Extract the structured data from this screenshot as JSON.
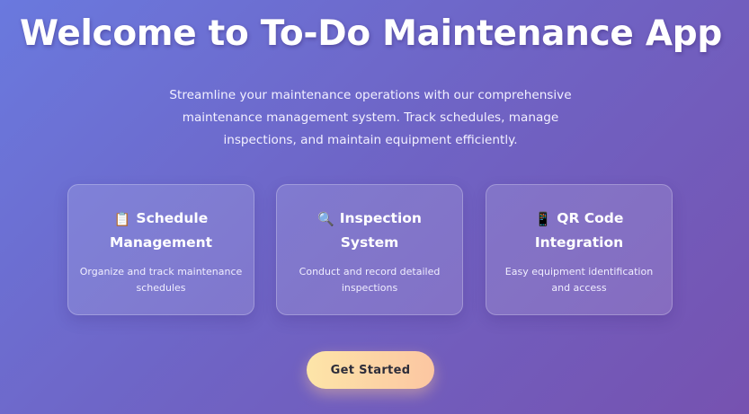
{
  "hero": {
    "title": "Welcome to To-Do Maintenance App",
    "subtitle": "Streamline your maintenance operations with our comprehensive maintenance management system. Track schedules, manage inspections, and maintain equipment efficiently."
  },
  "features": [
    {
      "icon": "clipboard-icon",
      "icon_glyph": "📋",
      "title": "Schedule Management",
      "description": "Organize and track maintenance schedules"
    },
    {
      "icon": "magnifying-glass-icon",
      "icon_glyph": "🔍",
      "title": "Inspection System",
      "description": "Conduct and record detailed inspections"
    },
    {
      "icon": "mobile-phone-icon",
      "icon_glyph": "📱",
      "title": "QR Code Integration",
      "description": "Easy equipment identification and access"
    }
  ],
  "cta": {
    "label": "Get Started"
  },
  "colors": {
    "background_start": "#6a79de",
    "background_end": "#7652b0",
    "button_start": "#fde5a8",
    "button_end": "#fcc6a2",
    "button_text": "#2d2d3a"
  }
}
